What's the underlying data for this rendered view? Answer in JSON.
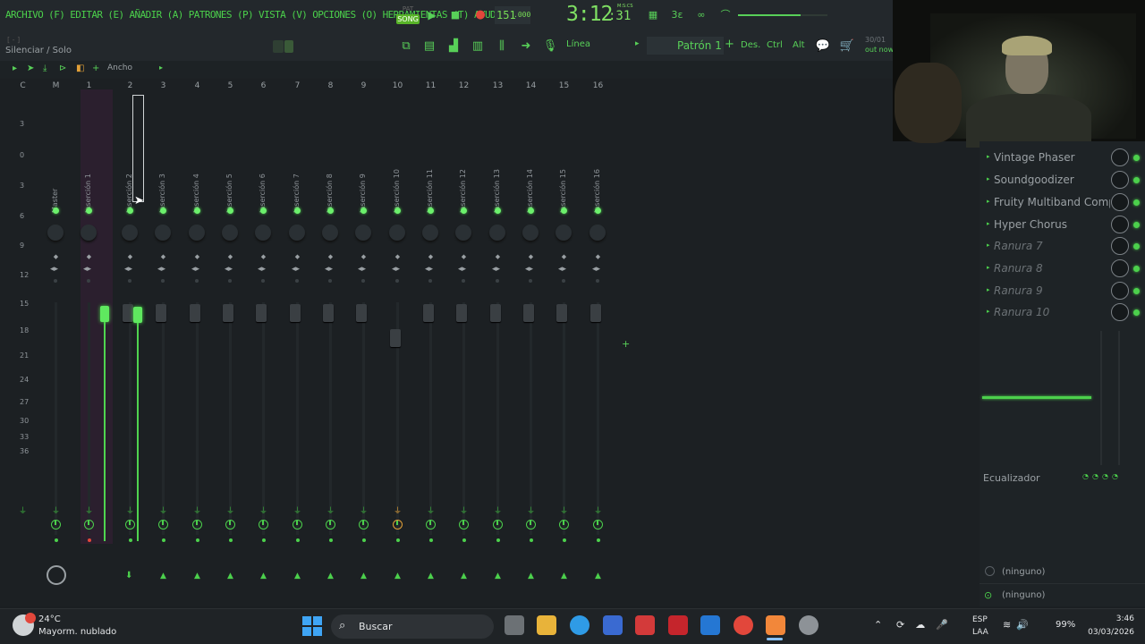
{
  "menu": {
    "text": "ARCHIVO (F) EDITAR (E) AÑADIR (A) PATRONES (P) VISTA (V) OPCIONES (O) HERRAMIENTAS (T) AYUDA"
  },
  "transport": {
    "pat_label": "PAT",
    "song_label": "SONG",
    "tempo": "151",
    "tempo_frac": ".000",
    "clock": "3:12",
    "clock_sub": ":31",
    "clock_label": "M:S:CS",
    "play_icon": "play-icon",
    "stop_icon": "stop-icon",
    "record_icon": "record-icon",
    "master_volume": 0.7
  },
  "toolbar2": {
    "brackets": "[ - ]",
    "hint": "Silenciar / Solo",
    "line_mode": "Línea",
    "pattern": "Patrón 1",
    "pattern_add": "+",
    "snap_des": "Des.",
    "snap_ctrl": "Ctrl",
    "snap_alt": "Alt",
    "info_date": "30/01",
    "info_out": "out now"
  },
  "mixer_tools": {
    "width_label": "Ancho"
  },
  "mixer": {
    "columns": [
      {
        "num": "C",
        "label": ""
      },
      {
        "num": "M",
        "label": "Master"
      },
      {
        "num": "1",
        "label": "Inserción 1"
      },
      {
        "num": "2",
        "label": "Inserción 2"
      },
      {
        "num": "3",
        "label": "Inserción 3"
      },
      {
        "num": "4",
        "label": "Inserción 4"
      },
      {
        "num": "5",
        "label": "Inserción 5"
      },
      {
        "num": "6",
        "label": "Inserción 6"
      },
      {
        "num": "7",
        "label": "Inserción 7"
      },
      {
        "num": "8",
        "label": "Inserción 8"
      },
      {
        "num": "9",
        "label": "Inserción 9"
      },
      {
        "num": "10",
        "label": "Inserción 10"
      },
      {
        "num": "11",
        "label": "Inserción 11"
      },
      {
        "num": "12",
        "label": "Inserción 12"
      },
      {
        "num": "13",
        "label": "Inserción 13"
      },
      {
        "num": "14",
        "label": "Inserción 14"
      },
      {
        "num": "15",
        "label": "Inserción 15"
      },
      {
        "num": "16",
        "label": "Inserción 16"
      }
    ],
    "db_scale": [
      "3",
      "0",
      "3",
      "6",
      "9",
      "12",
      "15",
      "18",
      "21",
      "24",
      "27",
      "30",
      "33",
      "36"
    ],
    "accent": "#4cd04c"
  },
  "effects": {
    "slots": [
      {
        "name": "Vintage Phaser",
        "empty": false
      },
      {
        "name": "Soundgoodizer",
        "empty": false
      },
      {
        "name": "Fruity Multiband Compr...",
        "empty": false
      },
      {
        "name": "Hyper Chorus",
        "empty": false
      },
      {
        "name": "Ranura 7",
        "empty": true
      },
      {
        "name": "Ranura 8",
        "empty": true
      },
      {
        "name": "Ranura 9",
        "empty": true
      },
      {
        "name": "Ranura 10",
        "empty": true
      }
    ],
    "eq_label": "Ecualizador",
    "route_in": "(ninguno)",
    "route_out": "(ninguno)"
  },
  "taskbar": {
    "weather_temp": "24°C",
    "weather_desc": "Mayorm. nublado",
    "search_placeholder": "Buscar",
    "lang1": "ESP",
    "lang2": "LAA",
    "battery": "99%",
    "time": "3:46",
    "date": "03/03/2026"
  }
}
